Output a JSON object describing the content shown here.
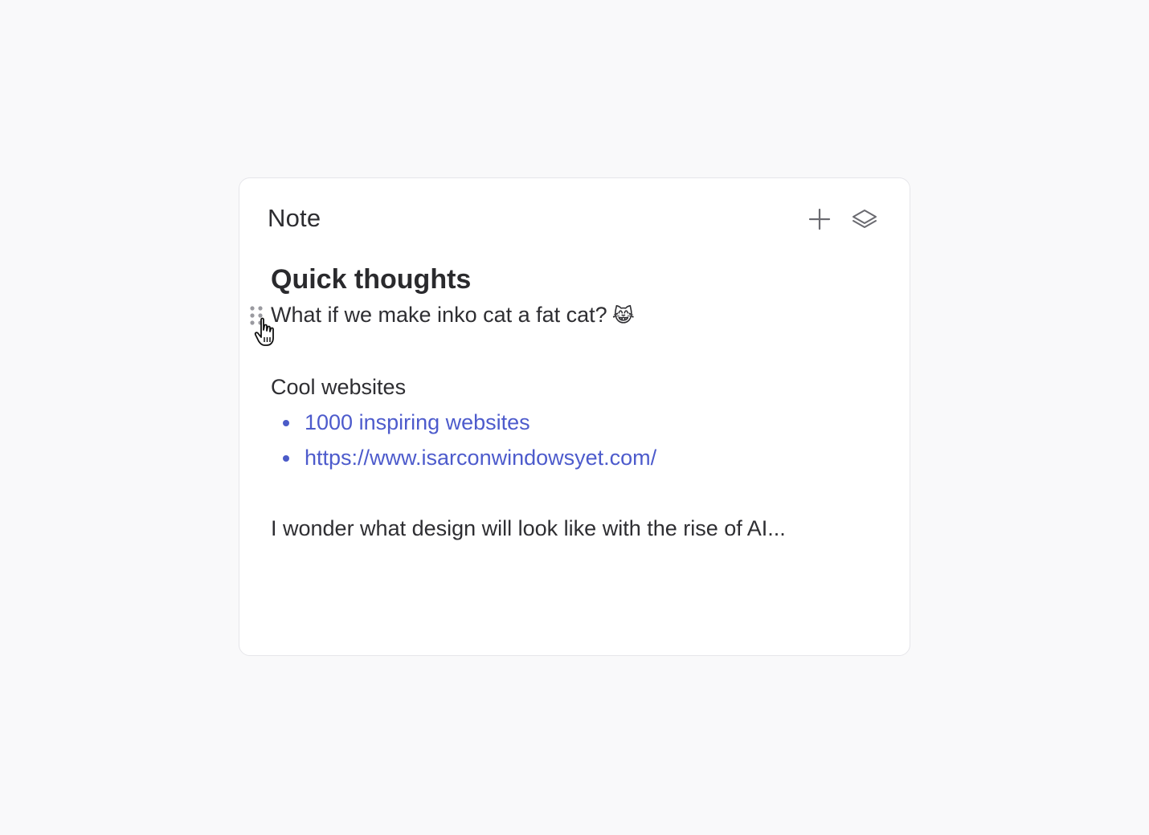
{
  "note": {
    "title": "Note",
    "actions": {
      "add_icon": "plus-icon",
      "layers_icon": "layers-icon"
    },
    "heading": "Quick thoughts",
    "line1": {
      "text": "What if we make inko cat a fat cat?",
      "emoji": "😹"
    },
    "section_title": "Cool websites",
    "links": [
      {
        "label": "1000 inspiring websites"
      },
      {
        "label": "https://www.isarconwindowsyet.com/"
      }
    ],
    "closing": "I wonder what design will look like with the rise of AI..."
  },
  "colors": {
    "background": "#f9f9fa",
    "card": "#ffffff",
    "link": "#4d5bcc",
    "text": "#2e2e32"
  }
}
